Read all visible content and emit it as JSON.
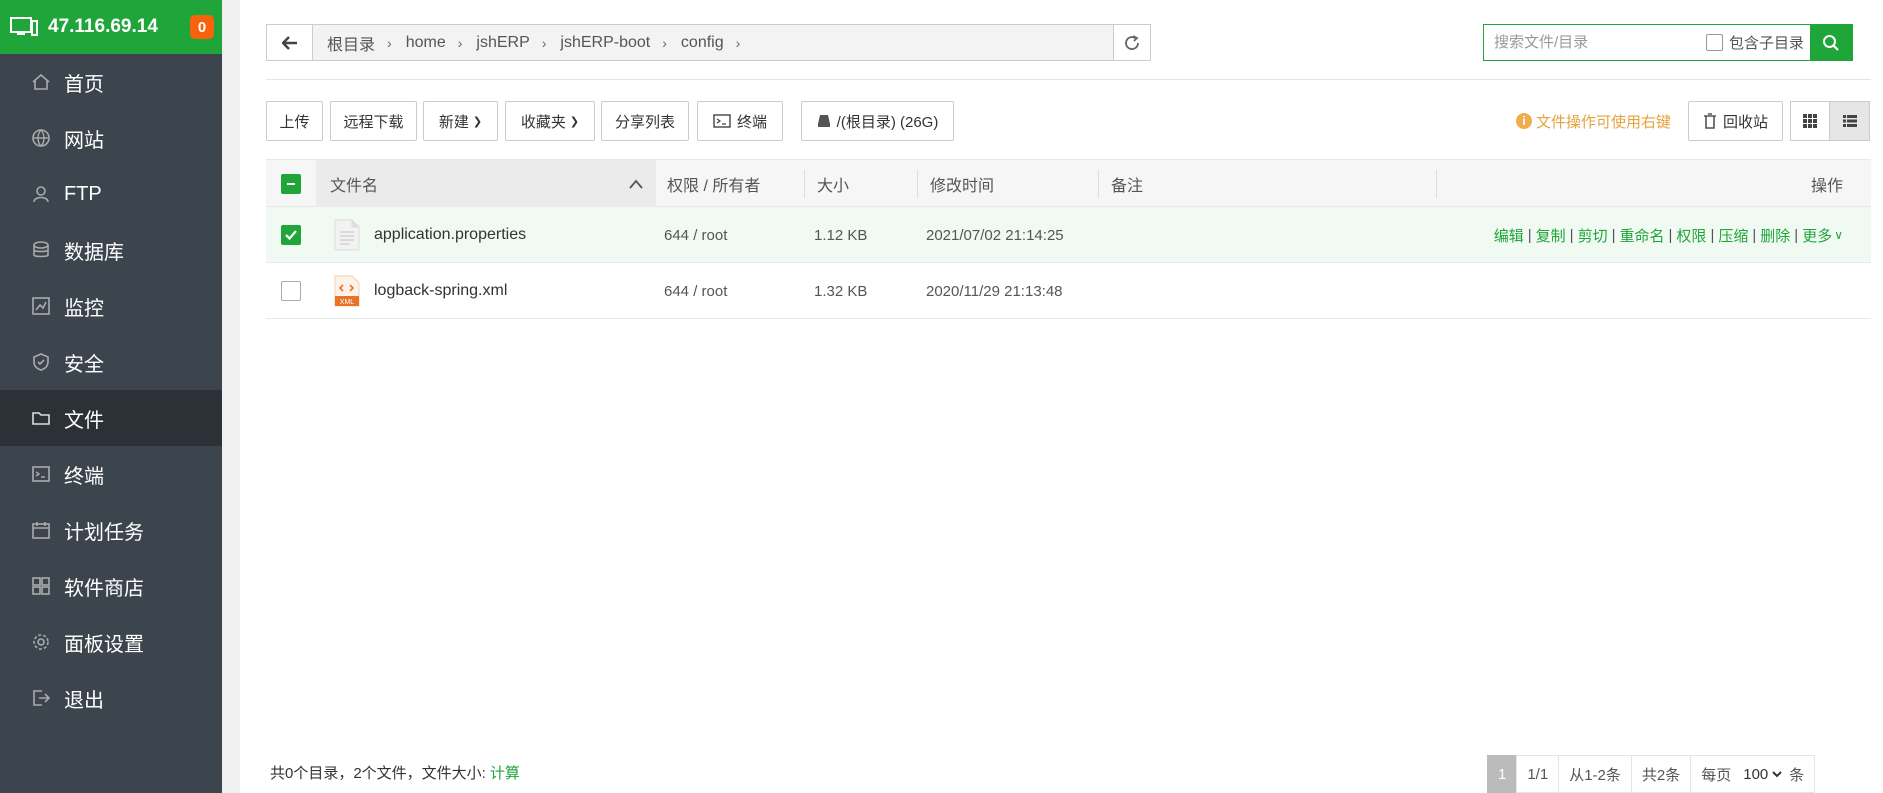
{
  "sidebar": {
    "ip": "47.116.69.14",
    "badge": "0",
    "items": [
      {
        "label": "首页"
      },
      {
        "label": "网站"
      },
      {
        "label": "FTP"
      },
      {
        "label": "数据库"
      },
      {
        "label": "监控"
      },
      {
        "label": "安全"
      },
      {
        "label": "文件"
      },
      {
        "label": "终端"
      },
      {
        "label": "计划任务"
      },
      {
        "label": "软件商店"
      },
      {
        "label": "面板设置"
      },
      {
        "label": "退出"
      }
    ],
    "active_index": 6
  },
  "path": {
    "crumbs": [
      "根目录",
      "home",
      "jshERP",
      "jshERP-boot",
      "config"
    ]
  },
  "search": {
    "placeholder": "搜索文件/目录",
    "include_subdir_label": "包含子目录"
  },
  "toolbar": {
    "upload": "上传",
    "remote_download": "远程下载",
    "new": "新建",
    "favorites": "收藏夹",
    "share_list": "分享列表",
    "terminal": "终端",
    "disk": "/(根目录) (26G)",
    "tip": "文件操作可使用右键",
    "recycle": "回收站"
  },
  "table": {
    "headers": {
      "name": "文件名",
      "perm": "权限 / 所有者",
      "size": "大小",
      "mtime": "修改时间",
      "remark": "备注",
      "ops": "操作"
    },
    "rows": [
      {
        "name": "application.properties",
        "perm": "644 / root",
        "size": "1.12 KB",
        "mtime": "2021/07/02 21:14:25",
        "selected": true
      },
      {
        "name": "logback-spring.xml",
        "perm": "644 / root",
        "size": "1.32 KB",
        "mtime": "2020/11/29 21:13:48",
        "selected": false
      }
    ],
    "ops": [
      "编辑",
      "复制",
      "剪切",
      "重命名",
      "权限",
      "压缩",
      "删除",
      "更多"
    ]
  },
  "footer": {
    "summary": "共0个目录，2个文件，文件大小:",
    "calc": "计算"
  },
  "pager": {
    "current": "1",
    "pages": "1/1",
    "range": "从1-2条",
    "total": "共2条",
    "per_page_label": "每页",
    "per_page": "100",
    "unit": "条"
  },
  "colors": {
    "accent": "#20a53a",
    "sidebar": "#3c444d",
    "badge": "#f7630c",
    "tip": "#e6a23c"
  }
}
